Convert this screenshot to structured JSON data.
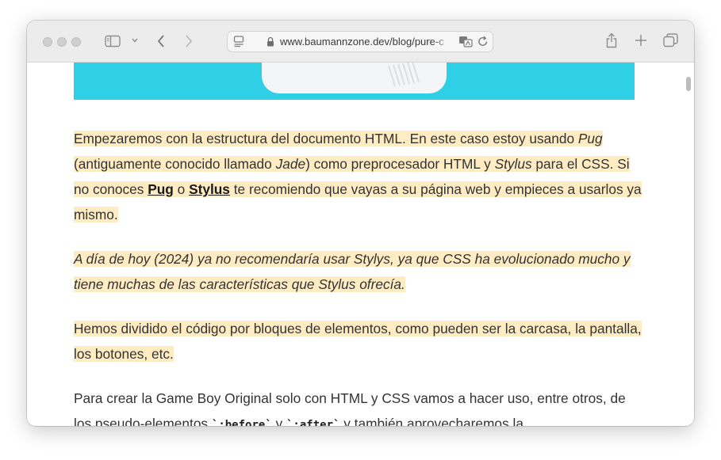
{
  "browser": {
    "url": "www.baumannzone.dev/blog/pure-c",
    "colors": {
      "toolbar_bg": "#ececec",
      "highlight": "#ffecc2",
      "hero_bg": "#2fcfe6"
    }
  },
  "article": {
    "p1": {
      "s1": "Empezaremos con la estructura del documento HTML. En este caso estoy usando ",
      "pug_italic": "Pug",
      "s2": " (antiguamente conocido llamado ",
      "jade_italic": "Jade",
      "s3": ") como preprocesador HTML y ",
      "stylus_italic": "Stylus",
      "s4": " para el CSS. Si no conoces ",
      "pug_link": "Pug",
      "s5": " o ",
      "stylus_link": "Stylus",
      "s6": " te recomiendo que vayas a su página web y empieces a usarlos ya mismo."
    },
    "p2": "A día de hoy (2024) ya no recomendaría usar Stylys, ya que CSS ha evolucionado mucho y tiene muchas de las características que Stylus ofrecía.",
    "p3": "Hemos dividido el código por bloques de elementos, como pueden ser la carcasa, la pantalla, los botones, etc.",
    "p4": {
      "s1": "Para crear la Game Boy Original solo con HTML y CSS vamos a hacer uso, entre otros, de los pseudo-elementos ",
      "code_before": "`:before`",
      "s2": " y ",
      "code_after": "`:after`",
      "s3": " y también aprovecharemos la"
    }
  }
}
